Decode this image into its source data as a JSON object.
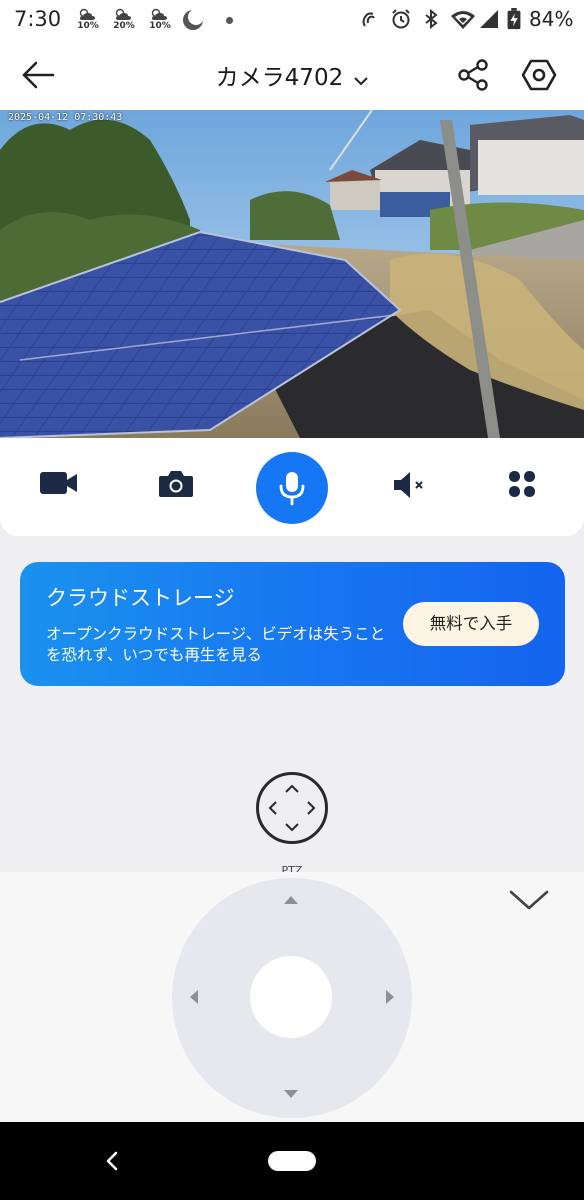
{
  "status_bar": {
    "time": "7:30",
    "weather": [
      {
        "icon": "cloudy-sun-icon",
        "percent": "10%"
      },
      {
        "icon": "cloudy-sun-icon",
        "percent": "20%"
      },
      {
        "icon": "cloudy-sun-icon",
        "percent": "10%"
      }
    ],
    "moon_icon": "moon-icon",
    "icons": [
      "nfc-icon",
      "alarm-icon",
      "bluetooth-icon",
      "wifi-icon",
      "signal-icon",
      "battery-charging-icon"
    ],
    "battery": "84%"
  },
  "header": {
    "title": "カメラ4702",
    "back_icon": "arrow-left-icon",
    "dropdown_icon": "chevron-down-icon",
    "share_icon": "share-icon",
    "settings_icon": "settings-hexagon-icon"
  },
  "video": {
    "osd_timestamp": "2025-04-12 07:30:43"
  },
  "controls": {
    "items": [
      "record-video-icon",
      "snapshot-camera-icon",
      "microphone-icon",
      "speaker-muted-icon",
      "more-grid-icon"
    ],
    "accent": "#1677f5"
  },
  "cloud_banner": {
    "title": "クラウドストレージ",
    "description": "オープンクラウドストレージ、ビデオは失うことを恐れず、いつでも再生を見る",
    "button_label": "無料で入手",
    "gradient_start": "#1a92ee",
    "gradient_end": "#1464ee"
  },
  "ptz": {
    "icon": "ptz-direction-icon",
    "label": "PTZ"
  },
  "joystick": {
    "collapse_icon": "chevron-down-icon",
    "arrows": [
      "up",
      "down",
      "left",
      "right"
    ]
  },
  "nav_bar": {
    "back_icon": "nav-back-icon",
    "home_icon": "nav-home-pill"
  }
}
